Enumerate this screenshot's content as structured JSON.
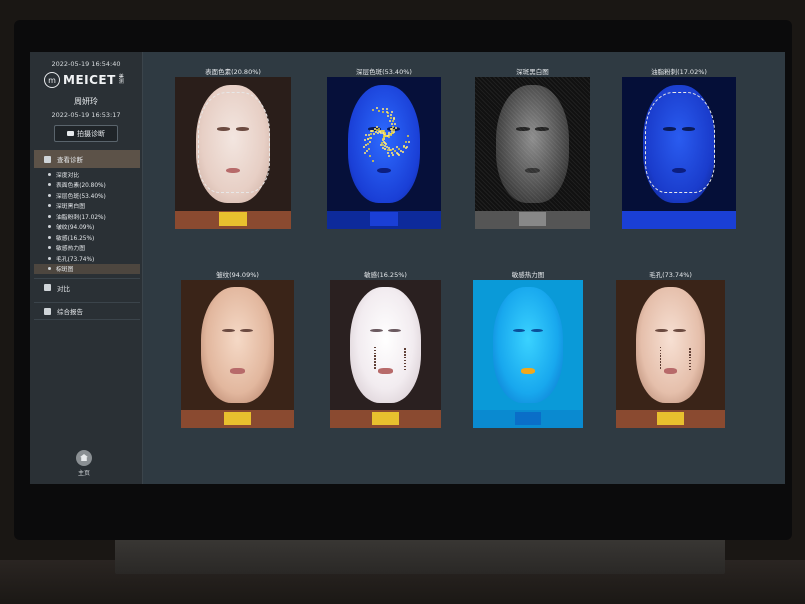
{
  "sidebar": {
    "timestamp_top": "2022-05-19 16:54:40",
    "logo_badge": "m",
    "logo_text": "MEICET",
    "logo_sub": "美测",
    "user_name": "周妍玲",
    "timestamp_capture": "2022-05-19 16:53:17",
    "shoot_button_label": "拍摄诊断",
    "menu": [
      {
        "label": "查看诊断",
        "active": true
      },
      {
        "label": "对比",
        "active": false
      },
      {
        "label": "综合报告",
        "active": false
      }
    ],
    "sub_items": [
      {
        "label": "深度对比",
        "selected": false
      },
      {
        "label": "表面色素(20.80%)",
        "selected": false
      },
      {
        "label": "深层色斑(53.40%)",
        "selected": false
      },
      {
        "label": "深斑黑白图",
        "selected": false
      },
      {
        "label": "油脂粉刺(17.02%)",
        "selected": false
      },
      {
        "label": "皱纹(94.09%)",
        "selected": false
      },
      {
        "label": "敏感(16.25%)",
        "selected": false
      },
      {
        "label": "敏感热力图",
        "selected": false
      },
      {
        "label": "毛孔(73.74%)",
        "selected": false
      },
      {
        "label": "棕斑图",
        "selected": true
      }
    ],
    "home_label": "主页"
  },
  "gallery": {
    "tiles": [
      {
        "title": "表面色素(20.80%)",
        "style": "white"
      },
      {
        "title": "深层色斑(53.40%)",
        "style": "bluespots"
      },
      {
        "title": "深斑黑白图",
        "style": "bw"
      },
      {
        "title": "油脂粉刺(17.02%)",
        "style": "bluemask"
      },
      {
        "title": "皱纹(94.09%)",
        "style": "warm"
      },
      {
        "title": "敏感(16.25%)",
        "style": "bright"
      },
      {
        "title": "敏感热力图",
        "style": "heat"
      },
      {
        "title": "毛孔(73.74%)",
        "style": "pores"
      }
    ]
  },
  "colors": {
    "screen_bg": "#2f3a42",
    "sidebar_bg": "#2a3035",
    "active_menu": "#5c5248",
    "accent_yellow": "#e8c02e"
  }
}
